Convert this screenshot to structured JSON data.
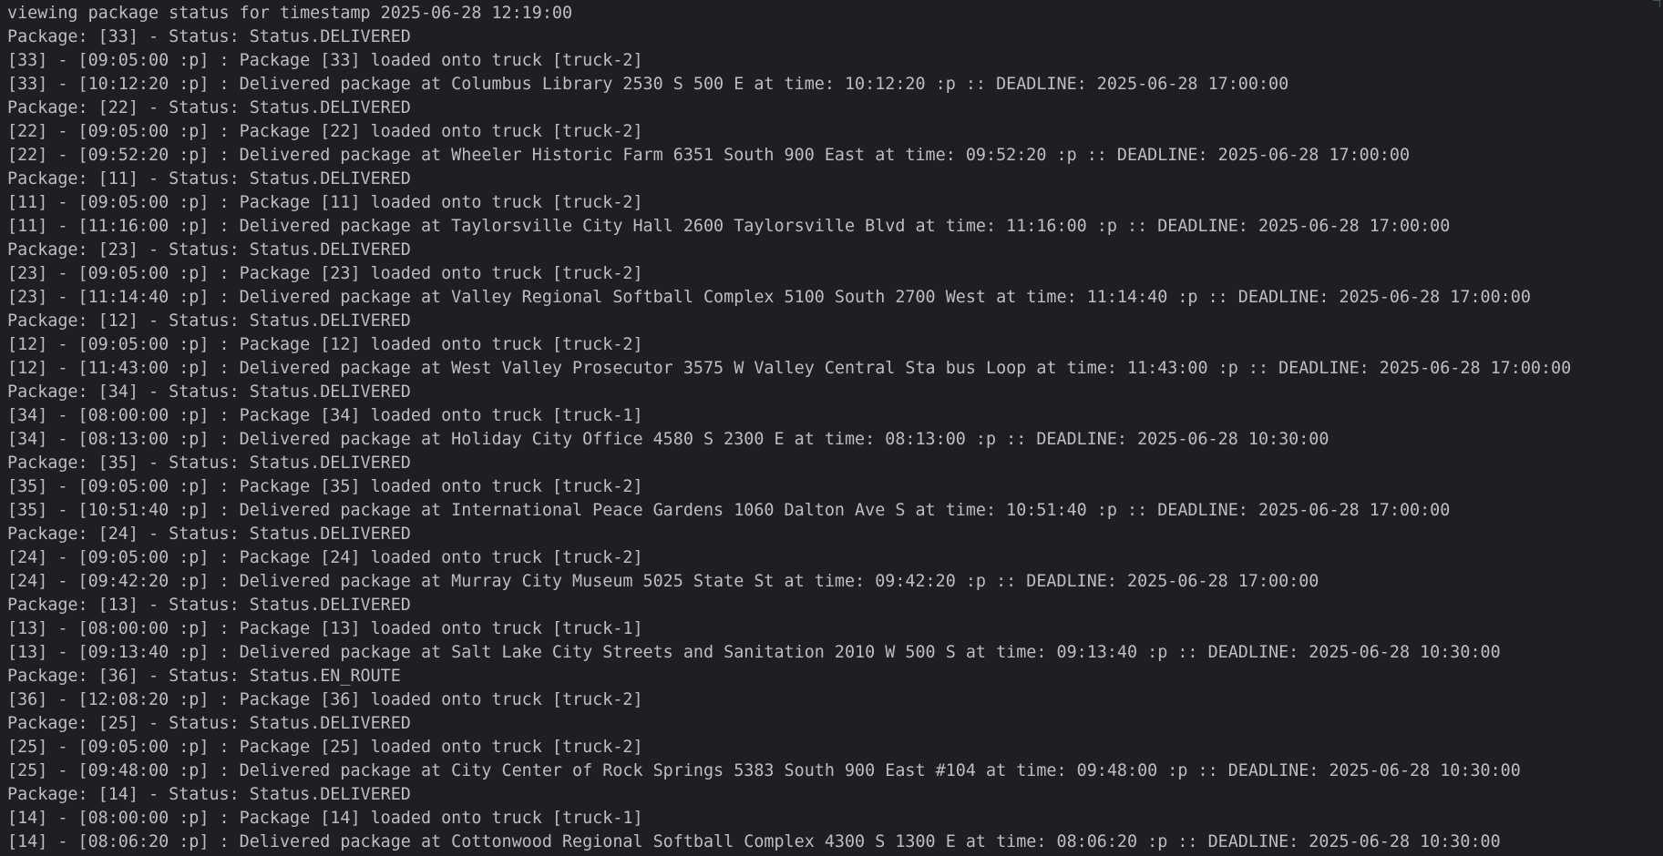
{
  "terminal": {
    "lines": [
      "viewing package status for timestamp 2025-06-28 12:19:00",
      "Package: [33] - Status: Status.DELIVERED",
      "[33] - [09:05:00 :p] : Package [33] loaded onto truck [truck-2]",
      "[33] - [10:12:20 :p] : Delivered package at Columbus Library 2530 S 500 E at time: 10:12:20 :p :: DEADLINE: 2025-06-28 17:00:00",
      "Package: [22] - Status: Status.DELIVERED",
      "[22] - [09:05:00 :p] : Package [22] loaded onto truck [truck-2]",
      "[22] - [09:52:20 :p] : Delivered package at Wheeler Historic Farm 6351 South 900 East at time: 09:52:20 :p :: DEADLINE: 2025-06-28 17:00:00",
      "Package: [11] - Status: Status.DELIVERED",
      "[11] - [09:05:00 :p] : Package [11] loaded onto truck [truck-2]",
      "[11] - [11:16:00 :p] : Delivered package at Taylorsville City Hall 2600 Taylorsville Blvd at time: 11:16:00 :p :: DEADLINE: 2025-06-28 17:00:00",
      "Package: [23] - Status: Status.DELIVERED",
      "[23] - [09:05:00 :p] : Package [23] loaded onto truck [truck-2]",
      "[23] - [11:14:40 :p] : Delivered package at Valley Regional Softball Complex 5100 South 2700 West at time: 11:14:40 :p :: DEADLINE: 2025-06-28 17:00:00",
      "Package: [12] - Status: Status.DELIVERED",
      "[12] - [09:05:00 :p] : Package [12] loaded onto truck [truck-2]",
      "[12] - [11:43:00 :p] : Delivered package at West Valley Prosecutor 3575 W Valley Central Sta bus Loop at time: 11:43:00 :p :: DEADLINE: 2025-06-28 17:00:00",
      "Package: [34] - Status: Status.DELIVERED",
      "[34] - [08:00:00 :p] : Package [34] loaded onto truck [truck-1]",
      "[34] - [08:13:00 :p] : Delivered package at Holiday City Office 4580 S 2300 E at time: 08:13:00 :p :: DEADLINE: 2025-06-28 10:30:00",
      "Package: [35] - Status: Status.DELIVERED",
      "[35] - [09:05:00 :p] : Package [35] loaded onto truck [truck-2]",
      "[35] - [10:51:40 :p] : Delivered package at International Peace Gardens 1060 Dalton Ave S at time: 10:51:40 :p :: DEADLINE: 2025-06-28 17:00:00",
      "Package: [24] - Status: Status.DELIVERED",
      "[24] - [09:05:00 :p] : Package [24] loaded onto truck [truck-2]",
      "[24] - [09:42:20 :p] : Delivered package at Murray City Museum 5025 State St at time: 09:42:20 :p :: DEADLINE: 2025-06-28 17:00:00",
      "Package: [13] - Status: Status.DELIVERED",
      "[13] - [08:00:00 :p] : Package [13] loaded onto truck [truck-1]",
      "[13] - [09:13:40 :p] : Delivered package at Salt Lake City Streets and Sanitation 2010 W 500 S at time: 09:13:40 :p :: DEADLINE: 2025-06-28 10:30:00",
      "Package: [36] - Status: Status.EN_ROUTE",
      "[36] - [12:08:20 :p] : Package [36] loaded onto truck [truck-2]",
      "Package: [25] - Status: Status.DELIVERED",
      "[25] - [09:05:00 :p] : Package [25] loaded onto truck [truck-2]",
      "[25] - [09:48:00 :p] : Delivered package at City Center of Rock Springs 5383 South 900 East #104 at time: 09:48:00 :p :: DEADLINE: 2025-06-28 10:30:00",
      "Package: [14] - Status: Status.DELIVERED",
      "[14] - [08:00:00 :p] : Package [14] loaded onto truck [truck-1]",
      "[14] - [08:06:20 :p] : Delivered package at Cottonwood Regional Softball Complex 4300 S 1300 E at time: 08:06:20 :p :: DEADLINE: 2025-06-28 10:30:00"
    ]
  },
  "colors": {
    "background": "#1e1f22",
    "text": "#bcbec4"
  },
  "icons": {
    "scroll_marker": "corner-marker-icon"
  }
}
